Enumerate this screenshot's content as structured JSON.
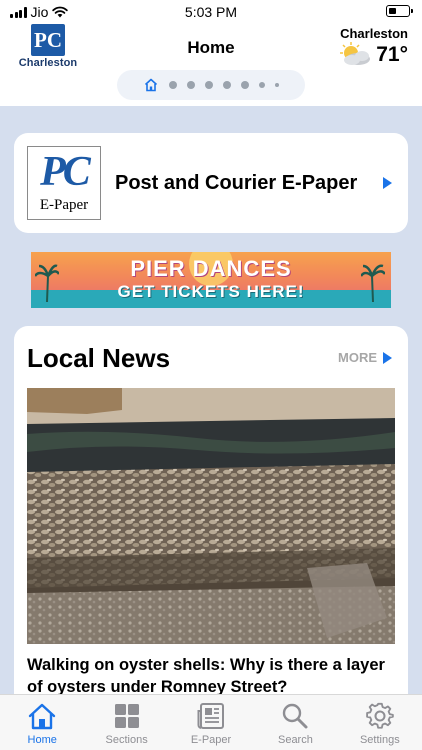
{
  "status_bar": {
    "carrier": "Jio",
    "time": "5:03 PM"
  },
  "header": {
    "brand_logo": "PC",
    "brand_label": "Charleston",
    "title": "Home",
    "weather": {
      "city": "Charleston",
      "temperature": "71°",
      "icon": "partly-cloudy-icon"
    }
  },
  "pager": {
    "pages": 8,
    "active_index": 0
  },
  "epaper_card": {
    "thumb_logo": "PC",
    "thumb_label": "E-Paper",
    "title": "Post and Courier E-Paper"
  },
  "ad_banner": {
    "line1": "PIER DANCES",
    "line2": "GET TICKETS HERE!"
  },
  "local_news": {
    "heading": "Local News",
    "more_label": "MORE",
    "headline": "Walking on oyster shells: Why is there a layer of oysters under Romney Street?"
  },
  "tabbar": {
    "tabs": [
      {
        "label": "Home",
        "icon": "home-icon",
        "active": true
      },
      {
        "label": "Sections",
        "icon": "grid-icon",
        "active": false
      },
      {
        "label": "E-Paper",
        "icon": "newspaper-icon",
        "active": false
      },
      {
        "label": "Search",
        "icon": "search-icon",
        "active": false
      },
      {
        "label": "Settings",
        "icon": "gear-icon",
        "active": false
      }
    ]
  },
  "colors": {
    "accent": "#1a73e8",
    "brand_blue": "#1d5aa6",
    "background": "#d5deee"
  }
}
